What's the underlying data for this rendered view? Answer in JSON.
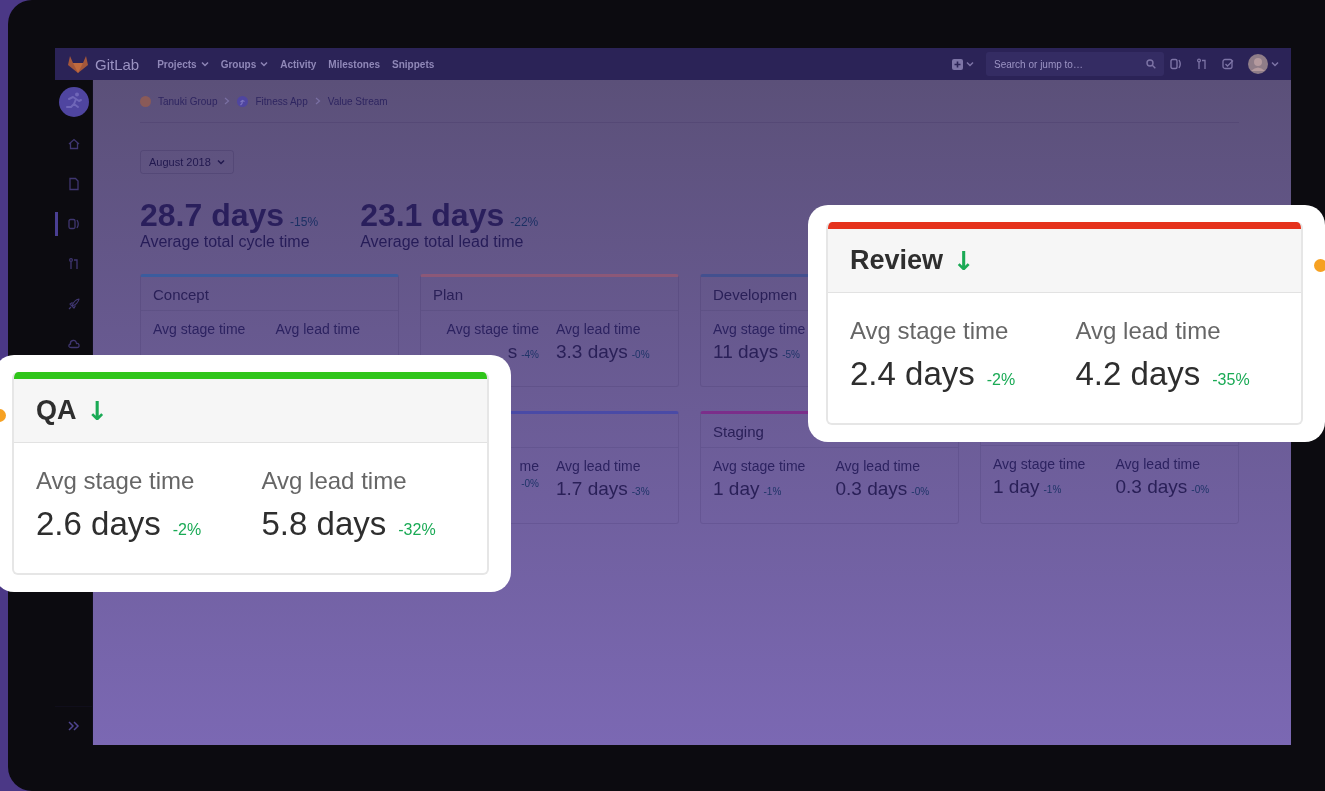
{
  "topbar": {
    "brand": "GitLab",
    "nav": [
      {
        "label": "Projects",
        "dropdown": true
      },
      {
        "label": "Groups",
        "dropdown": true
      },
      {
        "label": "Activity",
        "dropdown": false
      },
      {
        "label": "Milestones",
        "dropdown": false
      },
      {
        "label": "Snippets",
        "dropdown": false
      }
    ],
    "search": {
      "placeholder": "Search or jump to…"
    }
  },
  "sidebar": {
    "items": [
      {
        "kind": "house",
        "selected": false
      },
      {
        "kind": "document",
        "selected": false
      },
      {
        "kind": "panel",
        "selected": true
      },
      {
        "kind": "branch",
        "selected": false
      },
      {
        "kind": "rocket",
        "selected": false
      },
      {
        "kind": "cloud",
        "selected": false
      }
    ]
  },
  "breadcrumbs": [
    {
      "kind": "group",
      "label": "Tanuki Group"
    },
    {
      "kind": "project",
      "label": "Fitness App"
    },
    {
      "kind": "page",
      "label": "Value Stream"
    }
  ],
  "period_dropdown": {
    "value": "August 2018"
  },
  "summary": [
    {
      "value": "28.7 days",
      "delta": "-15%",
      "label": "Average total cycle time"
    },
    {
      "value": "23.1 days",
      "delta": "-22%",
      "label": "Average total lead time"
    }
  ],
  "stage_rows": [
    {
      "cards": [
        {
          "title": "Concept",
          "color": "#3b5c9e",
          "metrics": [
            {
              "label": "Avg stage time"
            },
            {
              "label": "Avg lead time"
            }
          ]
        },
        {
          "title": "Plan",
          "color": "#8c5878",
          "metrics": [
            {
              "label": "Avg stage time",
              "value": "s",
              "delta": "-4%",
              "cut": true
            },
            {
              "label": "Avg lead time",
              "value": "3.3 days",
              "delta": "-0%"
            }
          ]
        },
        {
          "title": "Developmen",
          "color": "#43508f",
          "metrics": [
            {
              "label": "Avg stage time",
              "value": "11 days",
              "delta": "-5%"
            }
          ]
        }
      ]
    },
    {
      "cards": [
        {
          "color": "#4a4aa6",
          "metrics": [
            {
              "label": "me",
              "delta": "-0%",
              "cut": true
            },
            {
              "label": "Avg lead time",
              "value": "1.7 days",
              "delta": "-3%"
            }
          ]
        },
        {
          "title": "Staging",
          "color": "#7b2e8a",
          "metrics": [
            {
              "label": "Avg stage time",
              "value": "1 day",
              "delta": "-1%"
            },
            {
              "label": "Avg lead time",
              "value": "0.3 days",
              "delta": "-0%"
            }
          ]
        },
        {
          "metrics": [
            {
              "label": "Avg stage time",
              "value": "1 day",
              "delta": "-1%"
            },
            {
              "label": "Avg lead time",
              "value": "0.3 days",
              "delta": "-0%"
            }
          ]
        }
      ]
    }
  ],
  "callouts": [
    {
      "title": "Review",
      "color": "#e5321c",
      "arrow": "↓",
      "metrics": [
        {
          "label": "Avg stage time",
          "value": "2.4 days",
          "delta": "-2%"
        },
        {
          "label": "Avg lead time",
          "value": "4.2 days",
          "delta": "-35%"
        }
      ]
    },
    {
      "title": "QA",
      "color": "#2fc51a",
      "arrow": "↓",
      "metrics": [
        {
          "label": "Avg stage time",
          "value": "2.6 days",
          "delta": "-2%"
        },
        {
          "label": "Avg lead time",
          "value": "5.8 days",
          "delta": "-32%"
        }
      ]
    }
  ]
}
